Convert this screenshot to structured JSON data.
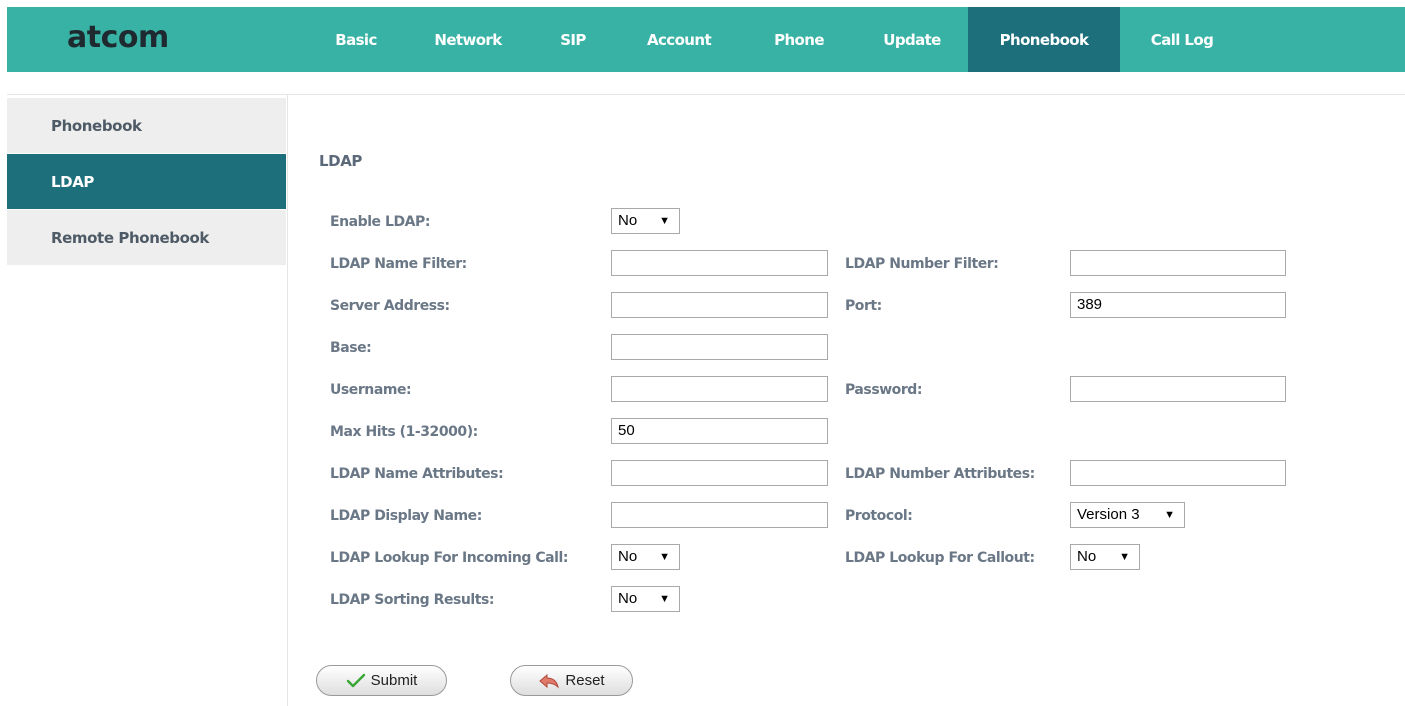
{
  "brand": {
    "logo_text": "atcom"
  },
  "nav": {
    "items": [
      {
        "label": "Basic"
      },
      {
        "label": "Network"
      },
      {
        "label": "SIP"
      },
      {
        "label": "Account"
      },
      {
        "label": "Phone"
      },
      {
        "label": "Update"
      },
      {
        "label": "Phonebook",
        "active": true
      },
      {
        "label": "Call Log"
      }
    ]
  },
  "sidebar": {
    "items": [
      {
        "label": "Phonebook"
      },
      {
        "label": "LDAP",
        "active": true
      },
      {
        "label": "Remote Phonebook"
      }
    ]
  },
  "section_title": "LDAP",
  "form": {
    "enable_ldap": {
      "label": "Enable LDAP:",
      "value": "No"
    },
    "name_filter": {
      "label": "LDAP Name Filter:",
      "value": ""
    },
    "number_filter": {
      "label": "LDAP Number Filter:",
      "value": ""
    },
    "server_address": {
      "label": "Server Address:",
      "value": ""
    },
    "port": {
      "label": "Port:",
      "value": "389"
    },
    "base": {
      "label": "Base:",
      "value": ""
    },
    "username": {
      "label": "Username:",
      "value": ""
    },
    "password": {
      "label": "Password:",
      "value": ""
    },
    "max_hits": {
      "label": "Max Hits (1-32000):",
      "value": "50"
    },
    "name_attributes": {
      "label": "LDAP Name Attributes:",
      "value": ""
    },
    "number_attributes": {
      "label": "LDAP Number Attributes:",
      "value": ""
    },
    "display_name": {
      "label": "LDAP Display Name:",
      "value": ""
    },
    "protocol": {
      "label": "Protocol:",
      "value": "Version 3"
    },
    "lookup_incoming": {
      "label": "LDAP Lookup For Incoming Call:",
      "value": "No"
    },
    "lookup_callout": {
      "label": "LDAP Lookup For Callout:",
      "value": "No"
    },
    "sorting_results": {
      "label": "LDAP Sorting Results:",
      "value": "No"
    }
  },
  "buttons": {
    "submit": "Submit",
    "reset": "Reset"
  },
  "colors": {
    "header": "#38b2a4",
    "active_tab": "#1c6f7b",
    "sidebar_bg": "#eeeeee"
  },
  "icons": {
    "submit": "checkmark-icon",
    "reset": "undo-arrow-icon"
  }
}
